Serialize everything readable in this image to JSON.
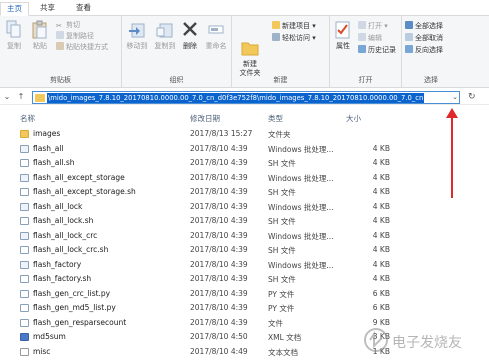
{
  "tabs": [
    "主页",
    "共享",
    "查看"
  ],
  "ribbon": {
    "clipboard": {
      "copy": "复制",
      "paste": "粘贴",
      "cut": "剪切",
      "copy_path": "复制路径",
      "paste_shortcut": "粘贴快捷方式",
      "label": "剪贴板"
    },
    "organize": {
      "move_to": "移动到",
      "copy_to": "复制到",
      "delete": "删除",
      "rename": "重命名",
      "label": "组织"
    },
    "new": {
      "new_folder": "新建\n文件夹",
      "new_item": "新建项目 ▾",
      "easy_access": "轻松访问 ▾",
      "label": "新建"
    },
    "open": {
      "properties": "属性",
      "open": "打开 ▾",
      "edit": "编辑",
      "history": "历史记录",
      "label": "打开"
    },
    "select": {
      "select_all": "全部选择",
      "select_none": "全部取消",
      "invert": "反向选择",
      "label": "选择"
    }
  },
  "address": {
    "path": "\\mido_images_7.8.10_20170810.0000.00_7.0_cn_d0f3e752f8\\mido_images_7.8.10_20170810.0000.00_7.0_cn"
  },
  "columns": {
    "name": "名称",
    "date": "修改日期",
    "type": "类型",
    "size": "大小"
  },
  "files": [
    {
      "name": "images",
      "date": "2017/8/13 15:27",
      "type": "文件夹",
      "size": "",
      "icon": "folder"
    },
    {
      "name": "flash_all",
      "date": "2017/8/10 4:39",
      "type": "Windows 批处理...",
      "size": "4 KB",
      "icon": "script"
    },
    {
      "name": "flash_all.sh",
      "date": "2017/8/10 4:39",
      "type": "SH 文件",
      "size": "4 KB",
      "icon": "file"
    },
    {
      "name": "flash_all_except_storage",
      "date": "2017/8/10 4:39",
      "type": "Windows 批处理...",
      "size": "4 KB",
      "icon": "script"
    },
    {
      "name": "flash_all_except_storage.sh",
      "date": "2017/8/10 4:39",
      "type": "SH 文件",
      "size": "4 KB",
      "icon": "file"
    },
    {
      "name": "flash_all_lock",
      "date": "2017/8/10 4:39",
      "type": "Windows 批处理...",
      "size": "4 KB",
      "icon": "script"
    },
    {
      "name": "flash_all_lock.sh",
      "date": "2017/8/10 4:39",
      "type": "SH 文件",
      "size": "4 KB",
      "icon": "file"
    },
    {
      "name": "flash_all_lock_crc",
      "date": "2017/8/10 4:39",
      "type": "Windows 批处理...",
      "size": "4 KB",
      "icon": "script"
    },
    {
      "name": "flash_all_lock_crc.sh",
      "date": "2017/8/10 4:39",
      "type": "SH 文件",
      "size": "4 KB",
      "icon": "file"
    },
    {
      "name": "flash_factory",
      "date": "2017/8/10 4:39",
      "type": "Windows 批处理...",
      "size": "4 KB",
      "icon": "script"
    },
    {
      "name": "flash_factory.sh",
      "date": "2017/8/10 4:39",
      "type": "SH 文件",
      "size": "4 KB",
      "icon": "file"
    },
    {
      "name": "flash_gen_crc_list.py",
      "date": "2017/8/10 4:39",
      "type": "PY 文件",
      "size": "6 KB",
      "icon": "file"
    },
    {
      "name": "flash_gen_md5_list.py",
      "date": "2017/8/10 4:39",
      "type": "PY 文件",
      "size": "6 KB",
      "icon": "file"
    },
    {
      "name": "flash_gen_resparsecount",
      "date": "2017/8/10 4:39",
      "type": "文件",
      "size": "9 KB",
      "icon": "file"
    },
    {
      "name": "md5sum",
      "date": "2017/8/10 4:50",
      "type": "XML 文档",
      "size": "3 KB",
      "icon": "xml"
    },
    {
      "name": "misc",
      "date": "2017/8/10 4:49",
      "type": "文本文档",
      "size": "1 KB",
      "icon": "text"
    }
  ],
  "watermark": "电子发烧友",
  "colors": {
    "accent": "#0b63ce",
    "arrow": "#e0292b",
    "folder": "#f2c85b"
  }
}
